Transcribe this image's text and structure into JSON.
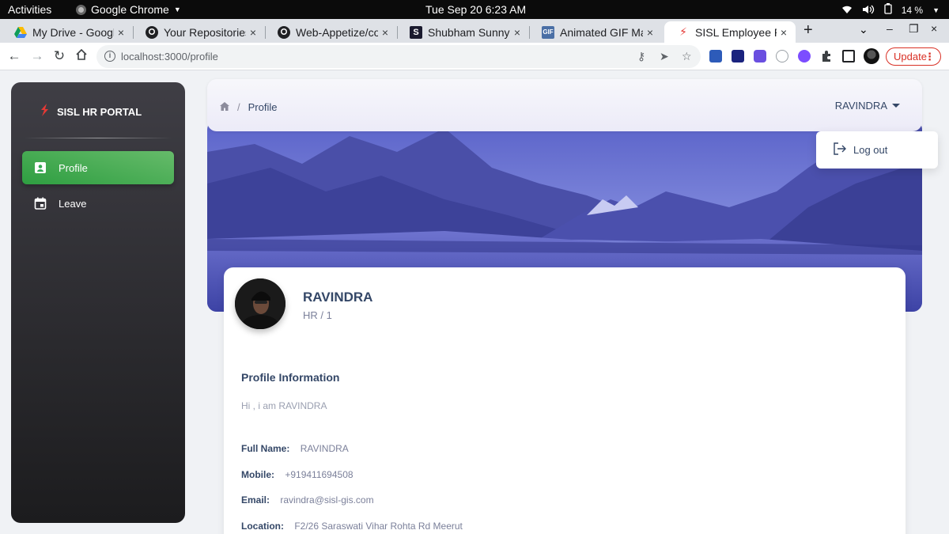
{
  "system_bar": {
    "activities": "Activities",
    "app_name": "Google Chrome",
    "clock": "Tue Sep 20  6:23 AM",
    "battery": "14 %"
  },
  "browser": {
    "tabs": [
      {
        "label": "My Drive - Google",
        "icon": "google-drive-icon"
      },
      {
        "label": "Your Repositories",
        "icon": "github-icon"
      },
      {
        "label": "Web-Appetize/con",
        "icon": "github-icon"
      },
      {
        "label": "Shubham Sunny | D",
        "icon": "site-logo-icon"
      },
      {
        "label": "Animated GIF Mak",
        "icon": "gif-maker-icon"
      },
      {
        "label": "SISL Employee Por",
        "icon": "sisl-icon",
        "active": true
      }
    ],
    "url": "localhost:3000/profile",
    "update_label": "Update"
  },
  "app": {
    "brand": "SISL HR PORTAL",
    "nav": [
      {
        "label": "Profile",
        "icon": "badge-icon",
        "active": true
      },
      {
        "label": "Leave",
        "icon": "calendar-icon",
        "active": false
      }
    ],
    "breadcrumb": {
      "current": "Profile"
    },
    "user": {
      "name": "RAVINDRA"
    },
    "dropdown": {
      "logout": "Log out"
    }
  },
  "profile": {
    "name": "RAVINDRA",
    "role": "HR / 1",
    "section_title": "Profile Information",
    "bio": "Hi , i am RAVINDRA",
    "fields": [
      {
        "label": "Full Name:",
        "value": "RAVINDRA"
      },
      {
        "label": "Mobile:",
        "value": "+919411694508"
      },
      {
        "label": "Email:",
        "value": "ravindra@sisl-gis.com"
      },
      {
        "label": "Location:",
        "value": "F2/26 Saraswati Vihar Rohta Rd Meerut"
      }
    ]
  },
  "colors": {
    "accent_green": "#2e9e41",
    "text_primary": "#344767",
    "banner_tint": "#4b4fa8",
    "update_red": "#d93025"
  }
}
